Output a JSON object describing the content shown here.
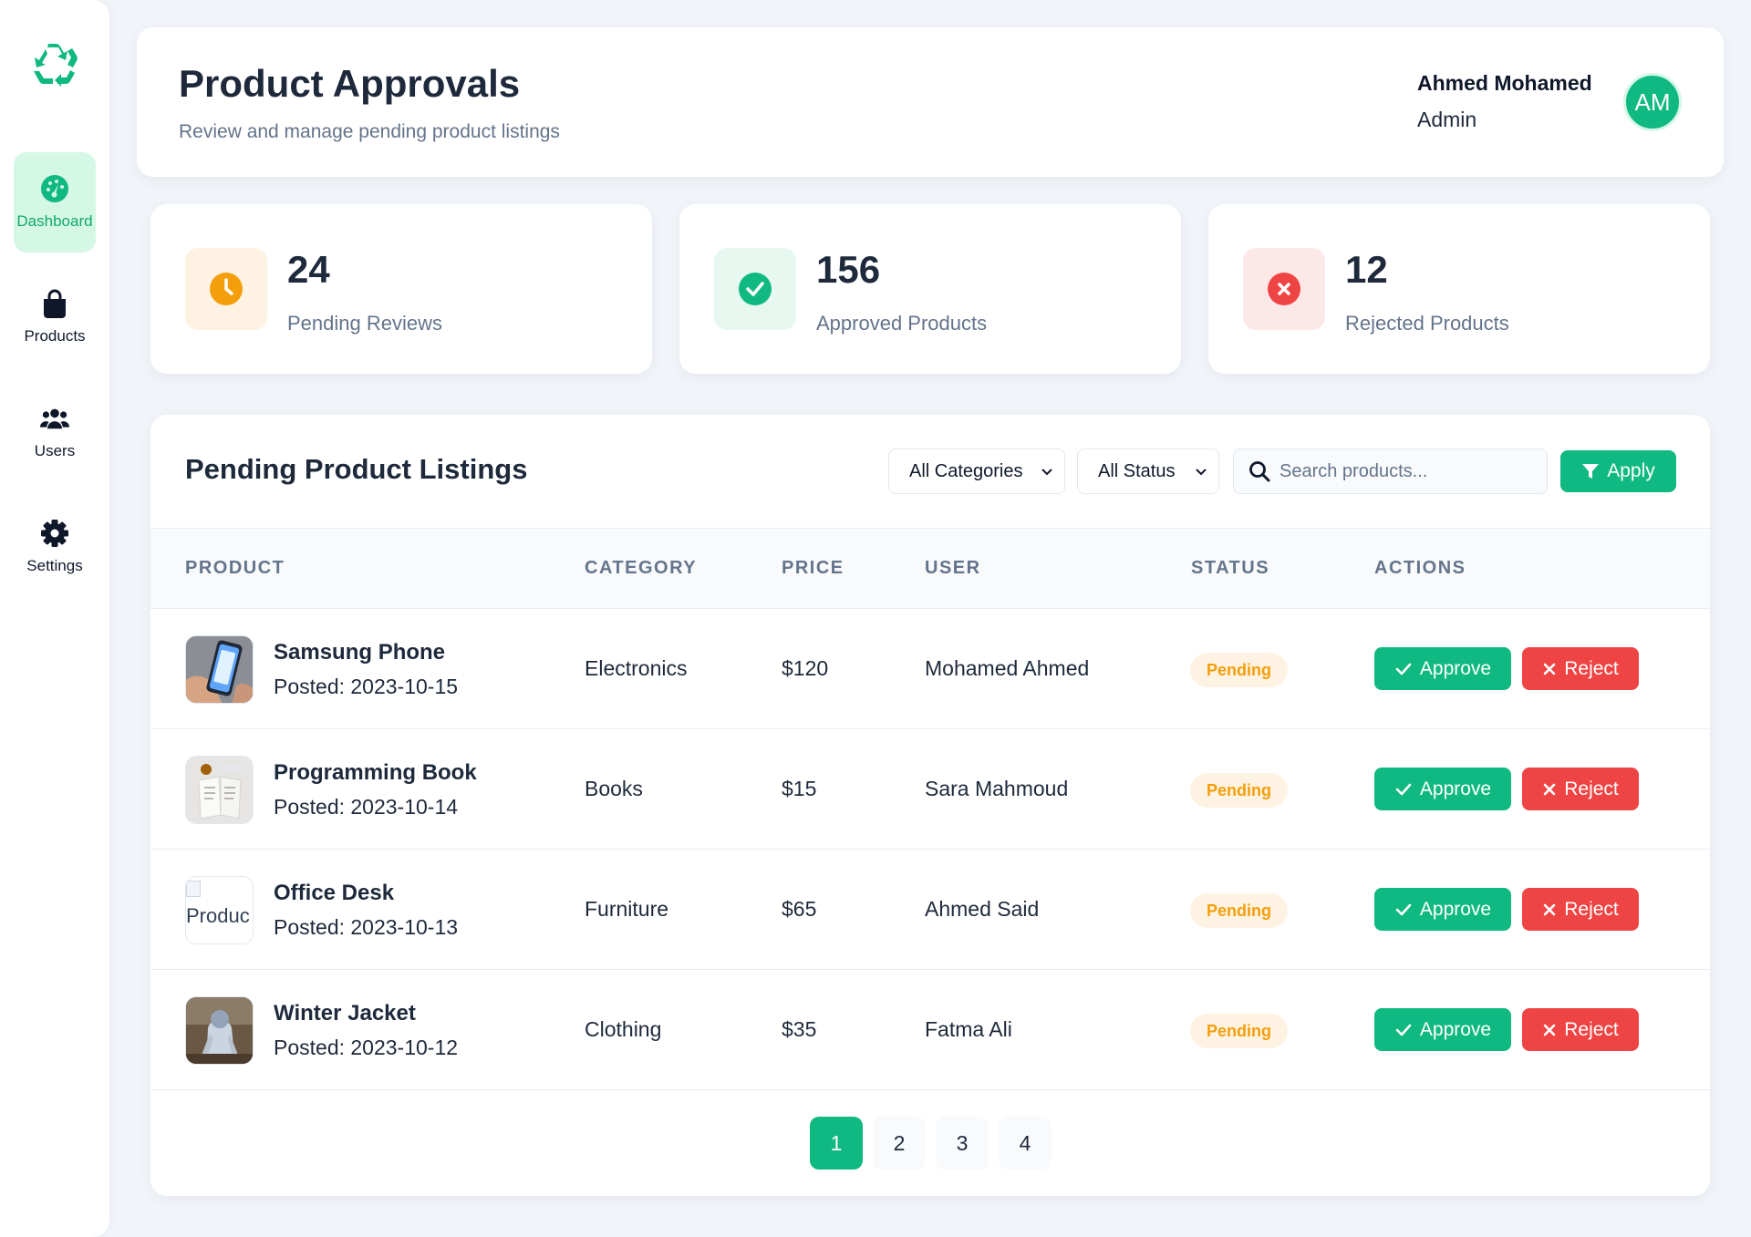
{
  "sidebar": {
    "logo": "recycle-icon",
    "items": [
      {
        "label": "Dashboard",
        "icon": "gauge-icon",
        "active": true
      },
      {
        "label": "Products",
        "icon": "shopping-bag-icon",
        "active": false
      },
      {
        "label": "Users",
        "icon": "users-icon",
        "active": false
      },
      {
        "label": "Settings",
        "icon": "gear-icon",
        "active": false
      }
    ]
  },
  "header": {
    "title": "Product Approvals",
    "subtitle": "Review and manage pending product listings",
    "user_name": "Ahmed Mohamed",
    "user_role": "Admin",
    "avatar_initials": "AM"
  },
  "stats": [
    {
      "value": "24",
      "label": "Pending Reviews",
      "icon": "clock-icon",
      "color": "#f59e0b",
      "bg": "#fef3e2"
    },
    {
      "value": "156",
      "label": "Approved Products",
      "icon": "check-circle-icon",
      "color": "#10b981",
      "bg": "#e6f8f0"
    },
    {
      "value": "12",
      "label": "Rejected Products",
      "icon": "x-circle-icon",
      "color": "#ef4444",
      "bg": "#fde8e8"
    }
  ],
  "listings": {
    "title": "Pending Product Listings",
    "category_filter": "All Categories",
    "status_filter": "All Status",
    "search_placeholder": "Search products...",
    "apply_label": "Apply",
    "columns": [
      "PRODUCT",
      "CATEGORY",
      "PRICE",
      "USER",
      "STATUS",
      "ACTIONS"
    ],
    "rows": [
      {
        "name": "Samsung Phone",
        "posted": "Posted: 2023-10-15",
        "category": "Electronics",
        "price": "$120",
        "user": "Mohamed Ahmed",
        "status": "Pending",
        "thumb": "phone"
      },
      {
        "name": "Programming Book",
        "posted": "Posted: 2023-10-14",
        "category": "Books",
        "price": "$15",
        "user": "Sara Mahmoud",
        "status": "Pending",
        "thumb": "book"
      },
      {
        "name": "Office Desk",
        "posted": "Posted: 2023-10-13",
        "category": "Furniture",
        "price": "$65",
        "user": "Ahmed Said",
        "status": "Pending",
        "thumb": "broken",
        "thumb_alt": "Produc"
      },
      {
        "name": "Winter Jacket",
        "posted": "Posted: 2023-10-12",
        "category": "Clothing",
        "price": "$35",
        "user": "Fatma Ali",
        "status": "Pending",
        "thumb": "jacket"
      }
    ],
    "approve_label": "Approve",
    "reject_label": "Reject",
    "pages": [
      "1",
      "2",
      "3",
      "4"
    ],
    "current_page": "1"
  },
  "colors": {
    "accent": "#10b981",
    "danger": "#ef4444",
    "warning": "#f59e0b",
    "background": "#f1f4f8"
  }
}
